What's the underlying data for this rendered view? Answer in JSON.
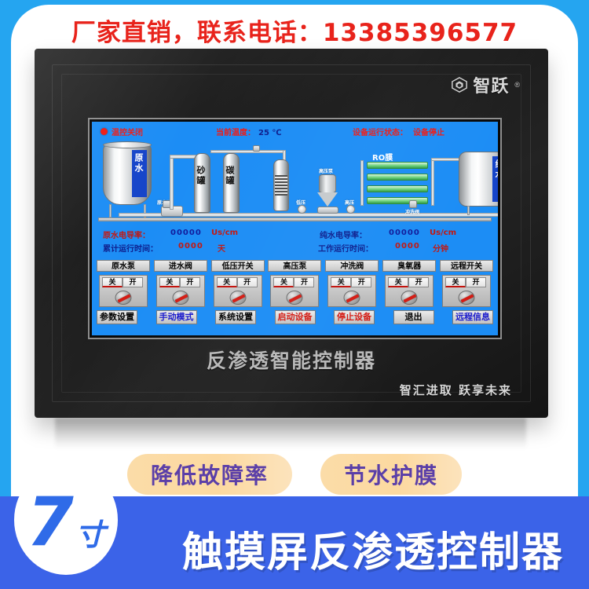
{
  "promo": {
    "text": "厂家直销，联系电话：13385396577"
  },
  "device": {
    "brand_name": "智跃",
    "brand_reg": "®",
    "model_text": "反渗透智能控制器",
    "slogan": "智汇进取  跃享未来"
  },
  "screen": {
    "status": {
      "temp_control_label": "温控关闭",
      "current_temp_label": "当前温度：",
      "current_temp_value": "25 ℃",
      "run_state_label": "设备运行状态：",
      "run_state_value": "设备停止"
    },
    "diagram": {
      "raw_tank_label": "原水",
      "pure_tank_label": "纯水",
      "sand_tank_label": "砂罐",
      "carbon_tank_label": "碳罐",
      "raw_pump_label": "原水泵",
      "low_press_label": "低压",
      "high_press_label": "高压",
      "high_pump_label": "高压泵",
      "ro_label": "RO膜",
      "flush_valve_label": "冲洗阀"
    },
    "data": {
      "raw_cond_label": "原水电导率：",
      "raw_cond_value": "00000",
      "raw_cond_unit": "Us/cm",
      "pure_cond_label": "纯水电导率：",
      "pure_cond_value": "00000",
      "pure_cond_unit": "Us/cm",
      "total_time_label": "累计运行时间：",
      "total_time_value": "0000",
      "total_time_unit": "天",
      "work_time_label": "工作运行时间：",
      "work_time_value": "0000",
      "work_time_unit": "分钟"
    },
    "switches": [
      {
        "title": "原水泵",
        "off": "关",
        "on": "开",
        "selected": "off"
      },
      {
        "title": "进水阀",
        "off": "关",
        "on": "开",
        "selected": "off"
      },
      {
        "title": "低压开关",
        "off": "关",
        "on": "开",
        "selected": "off"
      },
      {
        "title": "高压泵",
        "off": "关",
        "on": "开",
        "selected": "off"
      },
      {
        "title": "冲洗阀",
        "off": "关",
        "on": "开",
        "selected": "off"
      },
      {
        "title": "臭氧器",
        "off": "关",
        "on": "开",
        "selected": "off"
      },
      {
        "title": "远程开关",
        "off": "关",
        "on": "开",
        "selected": "off"
      }
    ],
    "actions": [
      {
        "label": "参数设置",
        "color": "#000000"
      },
      {
        "label": "手动模式",
        "color": "#1A1ACC"
      },
      {
        "label": "系统设置",
        "color": "#000000"
      },
      {
        "label": "启动设备",
        "color": "#D41A12"
      },
      {
        "label": "停止设备",
        "color": "#D41A12"
      },
      {
        "label": "退出",
        "color": "#000000"
      },
      {
        "label": "远程信息",
        "color": "#1A1ACC"
      }
    ]
  },
  "pills": [
    {
      "text": "降低故障率"
    },
    {
      "text": "节水护膜"
    }
  ],
  "banner": {
    "size_number": "7",
    "size_unit": "寸",
    "title": "触摸屏反渗透控制器"
  },
  "colors": {
    "promo_red": "#E8231B",
    "screen_blue": "#1C8DF5",
    "banner_blue": "#3B63E8",
    "pill_bg": "#FBDCA8",
    "pill_text": "#5B3FA8",
    "frame_cyan": "#25A5F0"
  }
}
